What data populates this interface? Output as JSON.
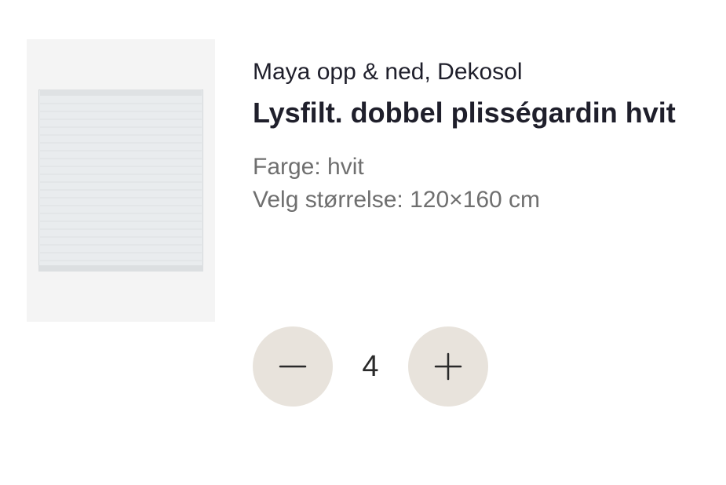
{
  "product": {
    "brand": "Maya opp & ned, Dekosol",
    "title": "Lysfilt. dobbel plisségardin hvit",
    "color_line": "Farge: hvit",
    "size_line": "Velg størrelse: 120×160 cm",
    "image_icon": "pleated-blind-image"
  },
  "quantity": {
    "value": "4",
    "decrease_icon": "minus-icon",
    "increase_icon": "plus-icon",
    "button_color": "#e8e3dc"
  }
}
